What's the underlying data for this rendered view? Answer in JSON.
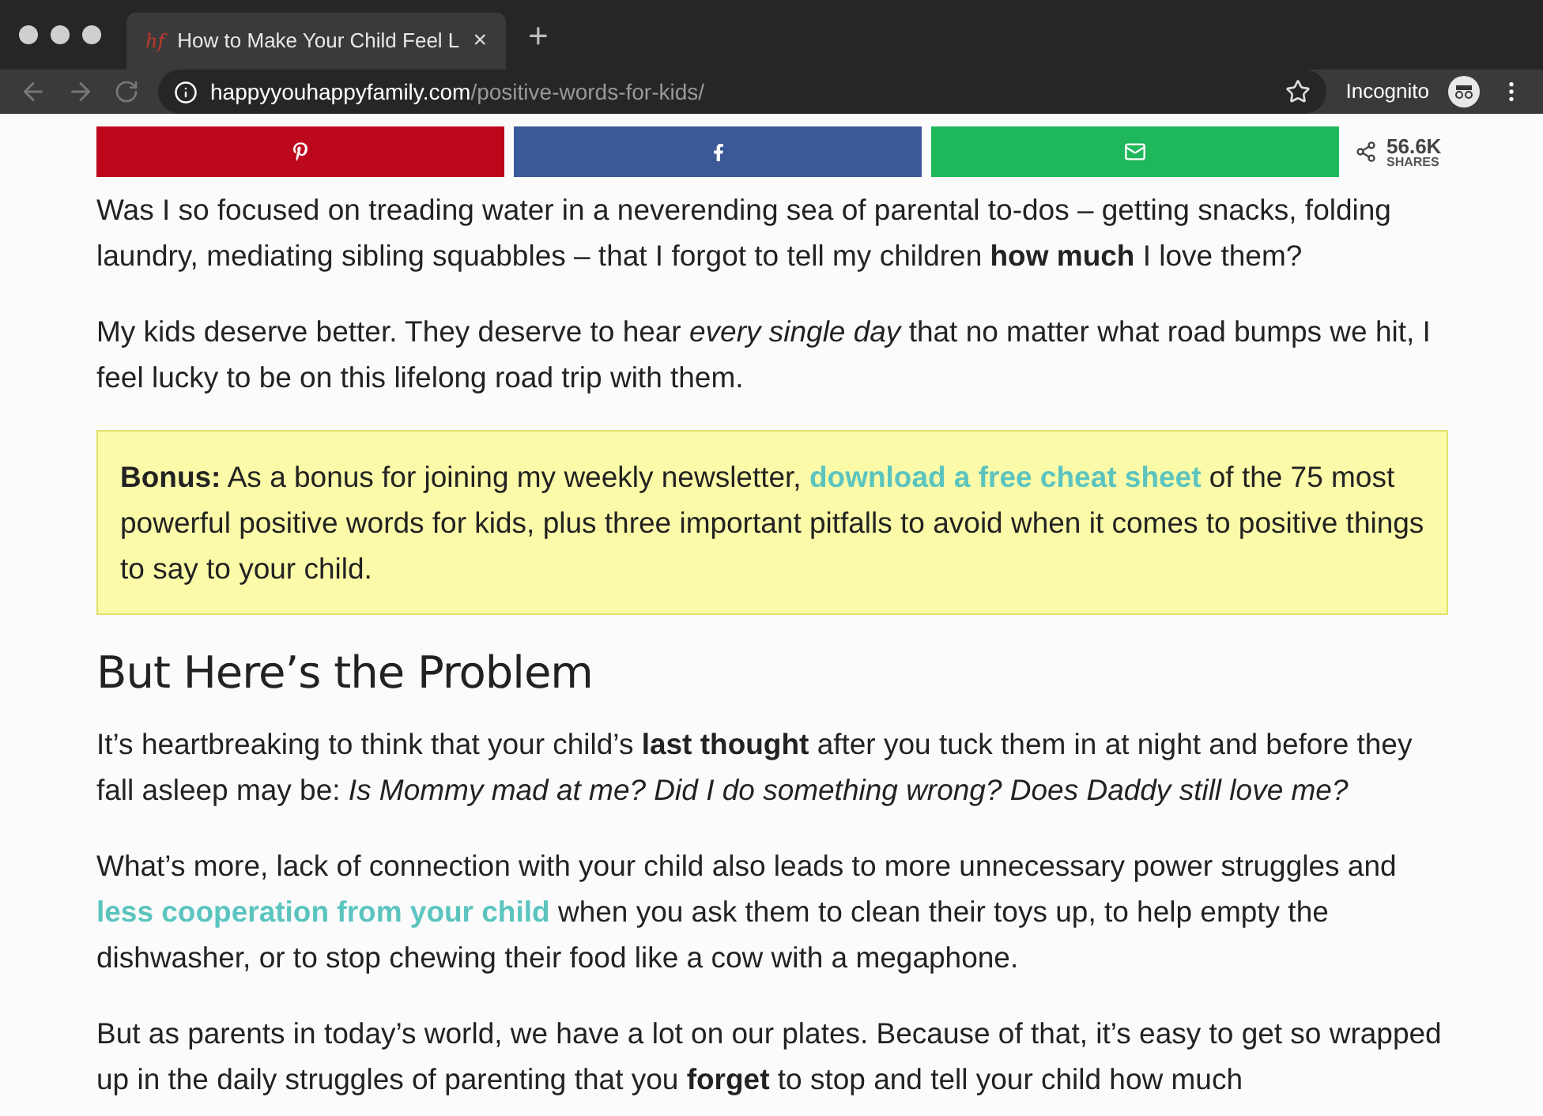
{
  "browser": {
    "tab": {
      "favicon": "hf",
      "title": "How to Make Your Child Feel L",
      "close": "×"
    },
    "new_tab": "+",
    "url": {
      "domain": "happyyouhappyfamily.com",
      "path": "/positive-words-for-kids/"
    },
    "profile": "Incognito"
  },
  "share_bar": {
    "buttons": [
      {
        "kind": "pinterest",
        "color": "#bd081c"
      },
      {
        "kind": "facebook",
        "color": "#3b5998"
      },
      {
        "kind": "email",
        "color": "#1fb75b"
      }
    ],
    "count": "56.6K",
    "count_label": "SHARES"
  },
  "content": [
    {
      "kind": "paragraph",
      "parts": [
        {
          "kind": "plain",
          "text": "Was I so focused on treading water in a neverending sea of parental to-dos – getting snacks, folding laundry, mediating sibling squabbles – that I forgot to tell my children "
        },
        {
          "kind": "bold",
          "text": "how much"
        },
        {
          "kind": "plain",
          "text": " I love them?"
        }
      ]
    },
    {
      "kind": "paragraph",
      "parts": [
        {
          "kind": "plain",
          "text": "My kids deserve better. They deserve to hear "
        },
        {
          "kind": "italic",
          "text": "every single day"
        },
        {
          "kind": "plain",
          "text": " that no matter what road bumps we hit, I feel lucky to be on this lifelong road trip with them."
        }
      ]
    },
    {
      "kind": "callout",
      "parts": [
        {
          "kind": "bold",
          "text": "Bonus:"
        },
        {
          "kind": "plain",
          "text": " As a bonus for joining my weekly newsletter, "
        },
        {
          "kind": "link",
          "text": "download a free cheat sheet"
        },
        {
          "kind": "plain",
          "text": " of the 75 most powerful positive words for kids, plus three important pitfalls to avoid when it comes to positive things to say to your child."
        }
      ]
    },
    {
      "kind": "heading",
      "parts": [
        {
          "kind": "plain",
          "text": "But Here’s the Problem"
        }
      ]
    },
    {
      "kind": "paragraph",
      "parts": [
        {
          "kind": "plain",
          "text": "It’s heartbreaking to think that your child’s "
        },
        {
          "kind": "bold",
          "text": "last thought"
        },
        {
          "kind": "plain",
          "text": " after you tuck them in at night and before they fall asleep may be: "
        },
        {
          "kind": "italic",
          "text": "Is Mommy mad at me? Did I do something wrong? Does Daddy still love me?"
        }
      ]
    },
    {
      "kind": "paragraph",
      "parts": [
        {
          "kind": "plain",
          "text": "What’s more, lack of connection with your child also leads to more unnecessary power struggles and "
        },
        {
          "kind": "link",
          "text": "less cooperation from your child"
        },
        {
          "kind": "plain",
          "text": " when you ask them to clean their toys up, to help empty the dishwasher, or to stop chewing their food like a cow with a megaphone."
        }
      ]
    },
    {
      "kind": "paragraph",
      "parts": [
        {
          "kind": "plain",
          "text": "But as parents in today’s world, we have a lot on our plates. Because of that, it’s easy to get so wrapped up in the daily struggles of parenting that you "
        },
        {
          "kind": "bold",
          "text": "forget"
        },
        {
          "kind": "plain",
          "text": " to stop and tell your child how much"
        }
      ]
    }
  ]
}
